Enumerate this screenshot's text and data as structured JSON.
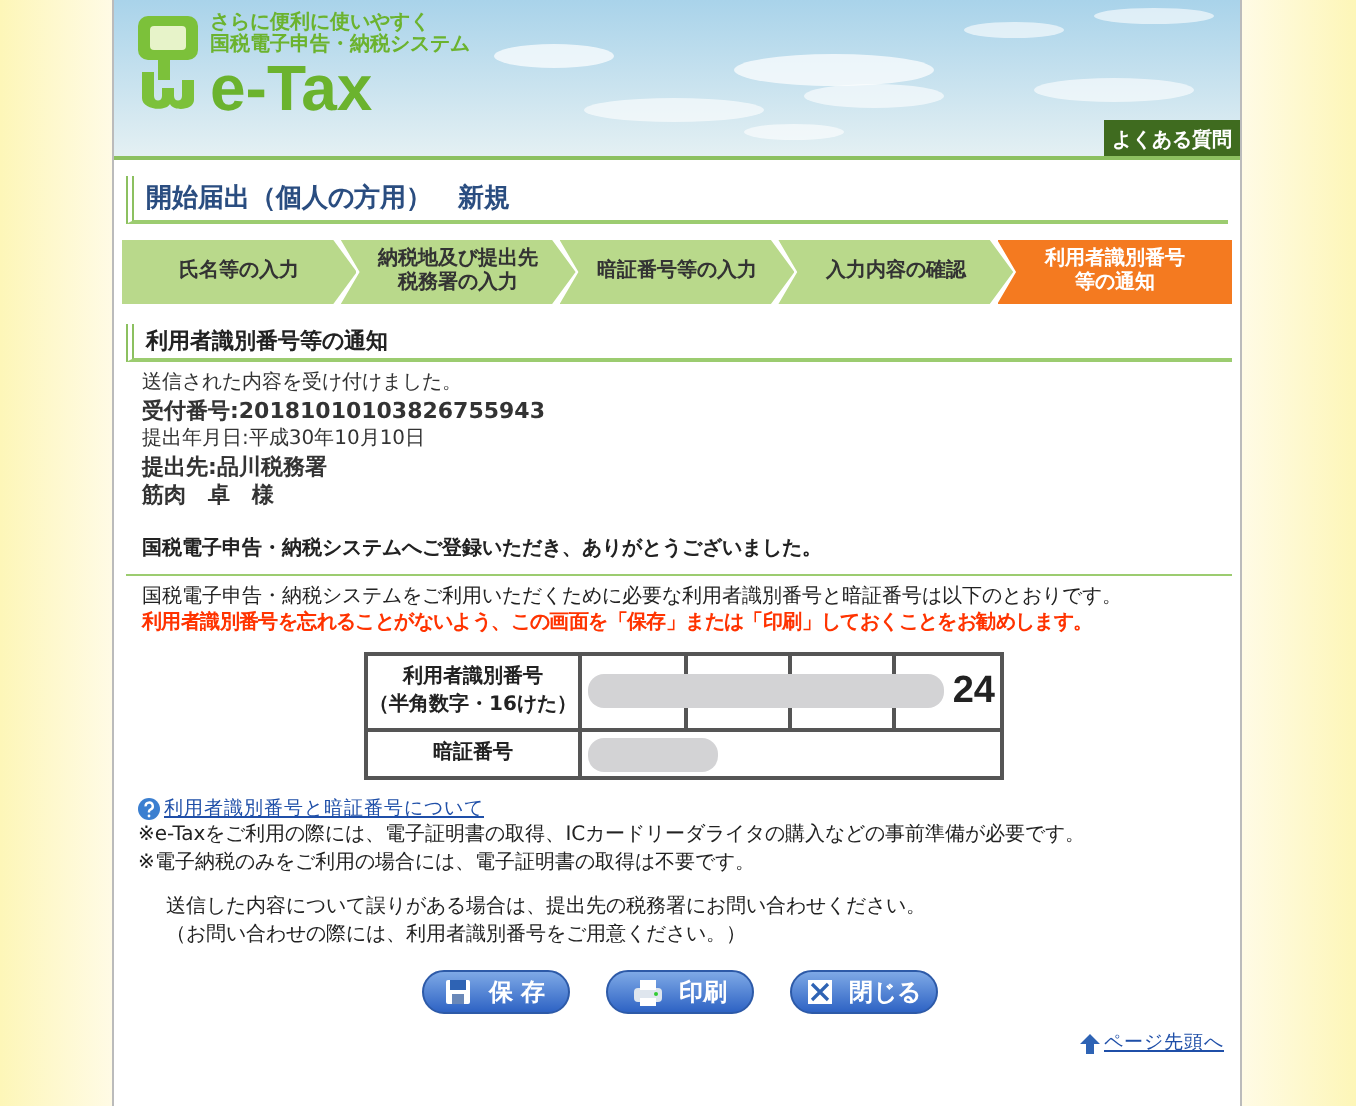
{
  "header": {
    "tagline_1": "さらに便利に使いやすく",
    "tagline_2": "国税電子申告・納税システム",
    "logo": "e-Tax",
    "faq_button": "よくある質問"
  },
  "page_title": "開始届出（個人の方用）　新規",
  "steps": [
    {
      "lines": [
        "氏名等の入力"
      ],
      "selected": false
    },
    {
      "lines": [
        "納税地及び提出先",
        "税務署の入力"
      ],
      "selected": false
    },
    {
      "lines": [
        "暗証番号等の入力"
      ],
      "selected": false
    },
    {
      "lines": [
        "入力内容の確認"
      ],
      "selected": false
    },
    {
      "lines": [
        "利用者識別番号",
        "等の通知"
      ],
      "selected": true
    }
  ],
  "section_title": "利用者識別番号等の通知",
  "receipt": [
    {
      "text": "送信された内容を受け付けました。",
      "kind": "small"
    },
    {
      "text": "受付番号:20181010103826755943",
      "kind": "large"
    },
    {
      "text": "提出年月日:平成30年10月10日",
      "kind": "small"
    },
    {
      "text": "提出先:品川税務署",
      "kind": "large"
    },
    {
      "text": "筋肉　卓　様",
      "kind": "large"
    }
  ],
  "thanks": "国税電子申告・納税システムへご登録いただき、ありがとうございました。",
  "info": "国税電子申告・納税システムをご利用いただくために必要な利用者識別番号と暗証番号は以下のとおりです。",
  "warning": "利用者識別番号を忘れることがないよう、この画面を「保存」または「印刷」しておくことをお勧めします。",
  "id_table": {
    "id_label": "利用者識別番号",
    "id_hint": "（半角数字・16けた）",
    "id_tail": "24",
    "pin_label": "暗証番号"
  },
  "help_link": "利用者識別番号と暗証番号について",
  "notes": [
    "※e-Taxをご利用の際には、電子証明書の取得、ICカードリーダライタの購入などの事前準備が必要です。",
    "※電子納税のみをご利用の場合には、電子証明書の取得は不要です。"
  ],
  "contact": [
    "送信した内容について誤りがある場合は、提出先の税務署にお問い合わせください。",
    "（お問い合わせの際には、利用者識別番号をご用意ください。）"
  ],
  "buttons": [
    {
      "label": "保 存",
      "kind": "save"
    },
    {
      "label": "印刷",
      "kind": "print"
    },
    {
      "label": "閉じる",
      "kind": "close"
    }
  ],
  "top_link": "ページ先頭へ"
}
